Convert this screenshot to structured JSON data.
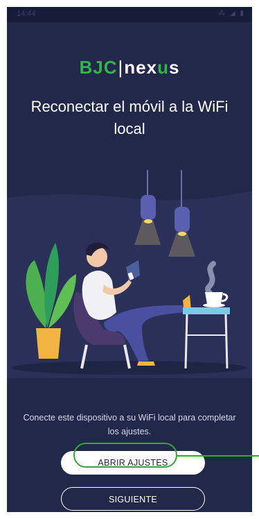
{
  "status_bar": {
    "time": "14:44",
    "icons": "⁂ ◢ ▮"
  },
  "brand": {
    "part1": "BJC",
    "separator": "|",
    "part2_start": "nex",
    "part2_accent": "u",
    "part2_end": "s"
  },
  "title": "Reconectar el móvil a la WiFi local",
  "description": "Conecte este dispositivo a su WiFi local para completar los ajustes.",
  "buttons": {
    "open_settings": "ABRIR AJUSTES",
    "next": "SIGUIENTE"
  },
  "colors": {
    "background": "#22284a",
    "accent": "#35a63a",
    "brand_green": "#34b24b"
  }
}
